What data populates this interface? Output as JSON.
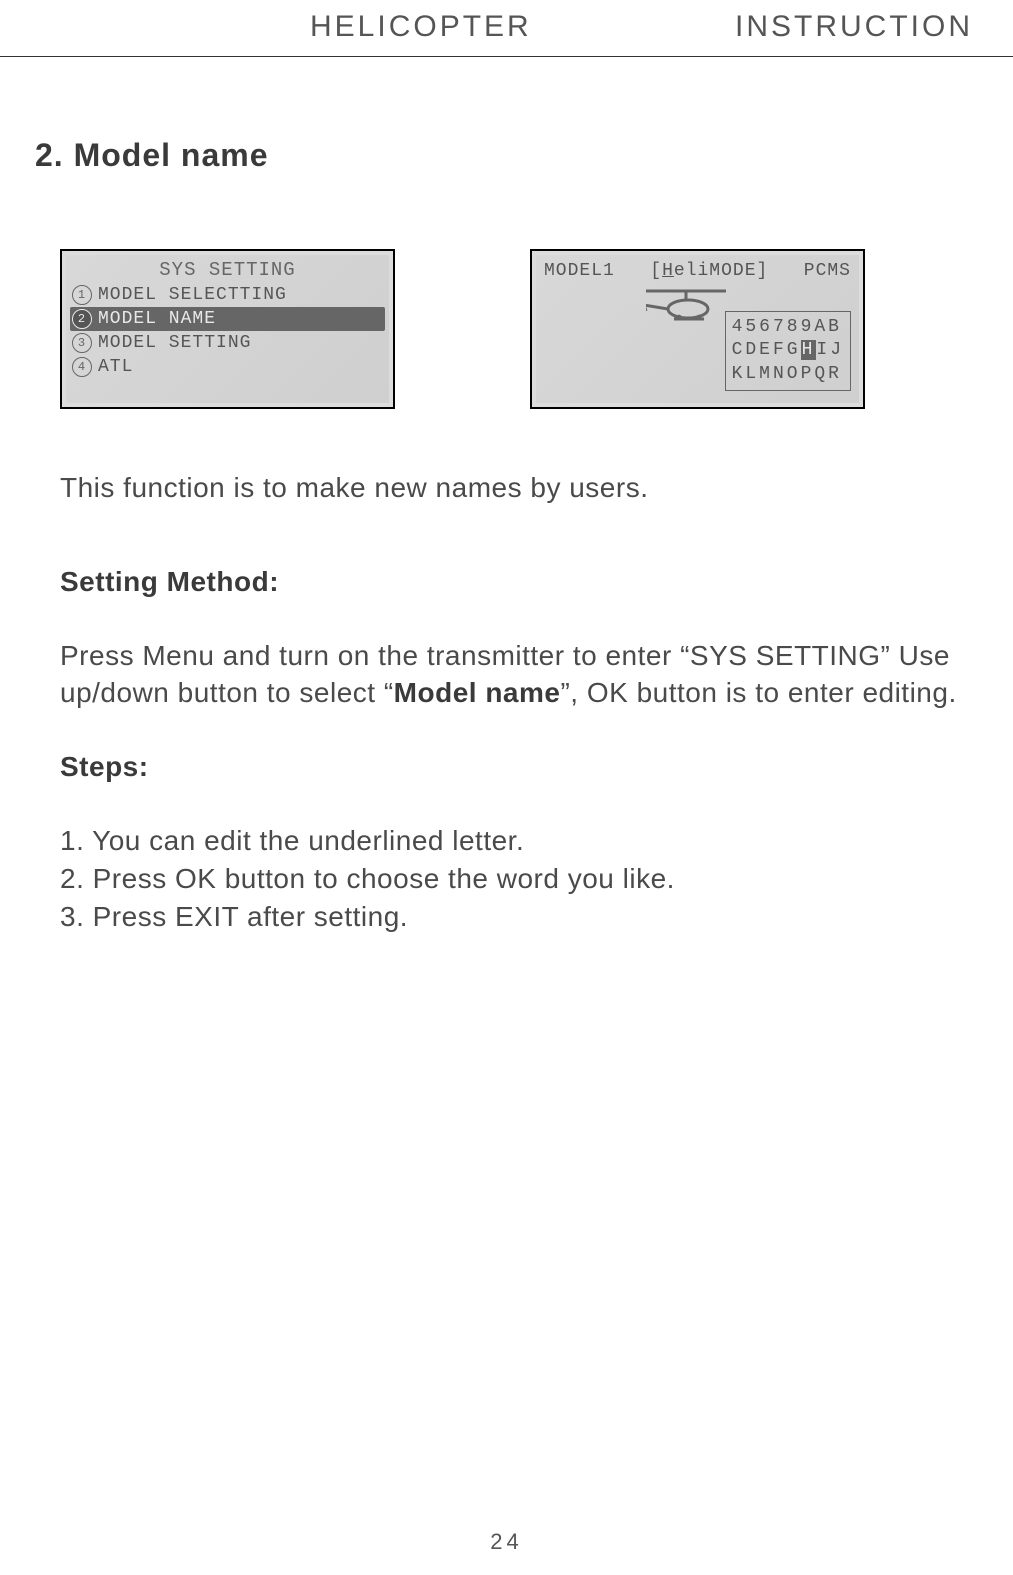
{
  "header": {
    "left": "HELICOPTER",
    "right": "INSTRUCTION"
  },
  "section_title": "2. Model name",
  "lcd1": {
    "title": "SYS SETTING",
    "items": [
      {
        "n": "1",
        "label": "MODEL SELECTTING",
        "selected": false
      },
      {
        "n": "2",
        "label": "MODEL NAME",
        "selected": true
      },
      {
        "n": "3",
        "label": "MODEL SETTING",
        "selected": false
      },
      {
        "n": "4",
        "label": "ATL",
        "selected": false
      }
    ]
  },
  "lcd2": {
    "top_left": "MODEL1",
    "top_mid_prefix": "[",
    "top_mid_underlined": "H",
    "top_mid_rest": "eliMODE]",
    "top_right": "PCMS",
    "grid": {
      "r1": "456789AB",
      "r2_pre": "CDEFG",
      "r2_hl": "H",
      "r2_post": "IJ",
      "r3": "KLMNOPQR"
    }
  },
  "body": {
    "intro": "This function is to make new names by users.",
    "setting_heading": "Setting Method:",
    "setting_p1a": "Press Menu and turn on the transmitter to enter “SYS SETTING” Use up/down button to select “",
    "setting_p1_bold": "Model name",
    "setting_p1b": "”, OK button is to enter editing.",
    "steps_heading": "Steps:",
    "step1": "1. You can edit the underlined letter.",
    "step2": "2. Press OK button to choose the word you like.",
    "step3": "3. Press EXIT after setting."
  },
  "page_number": "24"
}
